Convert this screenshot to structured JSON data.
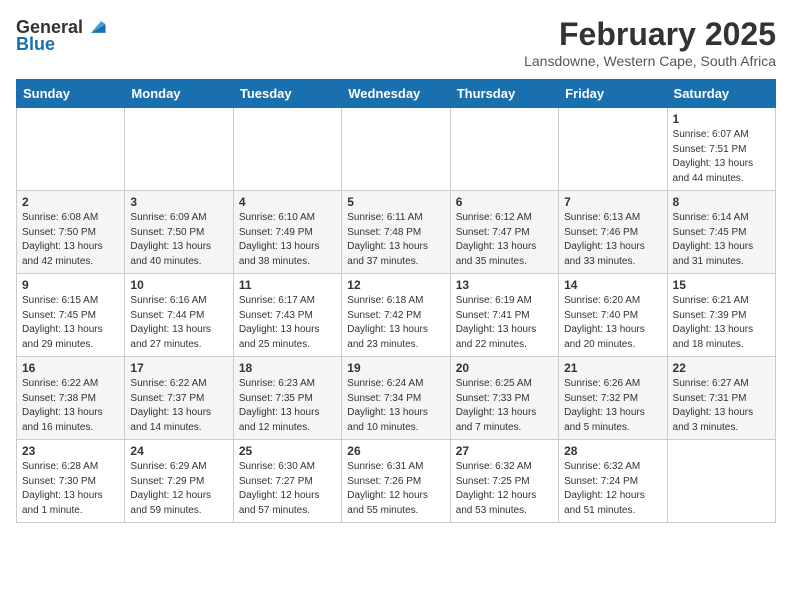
{
  "header": {
    "logo_general": "General",
    "logo_blue": "Blue",
    "month": "February 2025",
    "location": "Lansdowne, Western Cape, South Africa"
  },
  "days_of_week": [
    "Sunday",
    "Monday",
    "Tuesday",
    "Wednesday",
    "Thursday",
    "Friday",
    "Saturday"
  ],
  "weeks": [
    [
      {
        "day": "",
        "info": ""
      },
      {
        "day": "",
        "info": ""
      },
      {
        "day": "",
        "info": ""
      },
      {
        "day": "",
        "info": ""
      },
      {
        "day": "",
        "info": ""
      },
      {
        "day": "",
        "info": ""
      },
      {
        "day": "1",
        "info": "Sunrise: 6:07 AM\nSunset: 7:51 PM\nDaylight: 13 hours\nand 44 minutes."
      }
    ],
    [
      {
        "day": "2",
        "info": "Sunrise: 6:08 AM\nSunset: 7:50 PM\nDaylight: 13 hours\nand 42 minutes."
      },
      {
        "day": "3",
        "info": "Sunrise: 6:09 AM\nSunset: 7:50 PM\nDaylight: 13 hours\nand 40 minutes."
      },
      {
        "day": "4",
        "info": "Sunrise: 6:10 AM\nSunset: 7:49 PM\nDaylight: 13 hours\nand 38 minutes."
      },
      {
        "day": "5",
        "info": "Sunrise: 6:11 AM\nSunset: 7:48 PM\nDaylight: 13 hours\nand 37 minutes."
      },
      {
        "day": "6",
        "info": "Sunrise: 6:12 AM\nSunset: 7:47 PM\nDaylight: 13 hours\nand 35 minutes."
      },
      {
        "day": "7",
        "info": "Sunrise: 6:13 AM\nSunset: 7:46 PM\nDaylight: 13 hours\nand 33 minutes."
      },
      {
        "day": "8",
        "info": "Sunrise: 6:14 AM\nSunset: 7:45 PM\nDaylight: 13 hours\nand 31 minutes."
      }
    ],
    [
      {
        "day": "9",
        "info": "Sunrise: 6:15 AM\nSunset: 7:45 PM\nDaylight: 13 hours\nand 29 minutes."
      },
      {
        "day": "10",
        "info": "Sunrise: 6:16 AM\nSunset: 7:44 PM\nDaylight: 13 hours\nand 27 minutes."
      },
      {
        "day": "11",
        "info": "Sunrise: 6:17 AM\nSunset: 7:43 PM\nDaylight: 13 hours\nand 25 minutes."
      },
      {
        "day": "12",
        "info": "Sunrise: 6:18 AM\nSunset: 7:42 PM\nDaylight: 13 hours\nand 23 minutes."
      },
      {
        "day": "13",
        "info": "Sunrise: 6:19 AM\nSunset: 7:41 PM\nDaylight: 13 hours\nand 22 minutes."
      },
      {
        "day": "14",
        "info": "Sunrise: 6:20 AM\nSunset: 7:40 PM\nDaylight: 13 hours\nand 20 minutes."
      },
      {
        "day": "15",
        "info": "Sunrise: 6:21 AM\nSunset: 7:39 PM\nDaylight: 13 hours\nand 18 minutes."
      }
    ],
    [
      {
        "day": "16",
        "info": "Sunrise: 6:22 AM\nSunset: 7:38 PM\nDaylight: 13 hours\nand 16 minutes."
      },
      {
        "day": "17",
        "info": "Sunrise: 6:22 AM\nSunset: 7:37 PM\nDaylight: 13 hours\nand 14 minutes."
      },
      {
        "day": "18",
        "info": "Sunrise: 6:23 AM\nSunset: 7:35 PM\nDaylight: 13 hours\nand 12 minutes."
      },
      {
        "day": "19",
        "info": "Sunrise: 6:24 AM\nSunset: 7:34 PM\nDaylight: 13 hours\nand 10 minutes."
      },
      {
        "day": "20",
        "info": "Sunrise: 6:25 AM\nSunset: 7:33 PM\nDaylight: 13 hours\nand 7 minutes."
      },
      {
        "day": "21",
        "info": "Sunrise: 6:26 AM\nSunset: 7:32 PM\nDaylight: 13 hours\nand 5 minutes."
      },
      {
        "day": "22",
        "info": "Sunrise: 6:27 AM\nSunset: 7:31 PM\nDaylight: 13 hours\nand 3 minutes."
      }
    ],
    [
      {
        "day": "23",
        "info": "Sunrise: 6:28 AM\nSunset: 7:30 PM\nDaylight: 13 hours\nand 1 minute."
      },
      {
        "day": "24",
        "info": "Sunrise: 6:29 AM\nSunset: 7:29 PM\nDaylight: 12 hours\nand 59 minutes."
      },
      {
        "day": "25",
        "info": "Sunrise: 6:30 AM\nSunset: 7:27 PM\nDaylight: 12 hours\nand 57 minutes."
      },
      {
        "day": "26",
        "info": "Sunrise: 6:31 AM\nSunset: 7:26 PM\nDaylight: 12 hours\nand 55 minutes."
      },
      {
        "day": "27",
        "info": "Sunrise: 6:32 AM\nSunset: 7:25 PM\nDaylight: 12 hours\nand 53 minutes."
      },
      {
        "day": "28",
        "info": "Sunrise: 6:32 AM\nSunset: 7:24 PM\nDaylight: 12 hours\nand 51 minutes."
      },
      {
        "day": "",
        "info": ""
      }
    ]
  ]
}
